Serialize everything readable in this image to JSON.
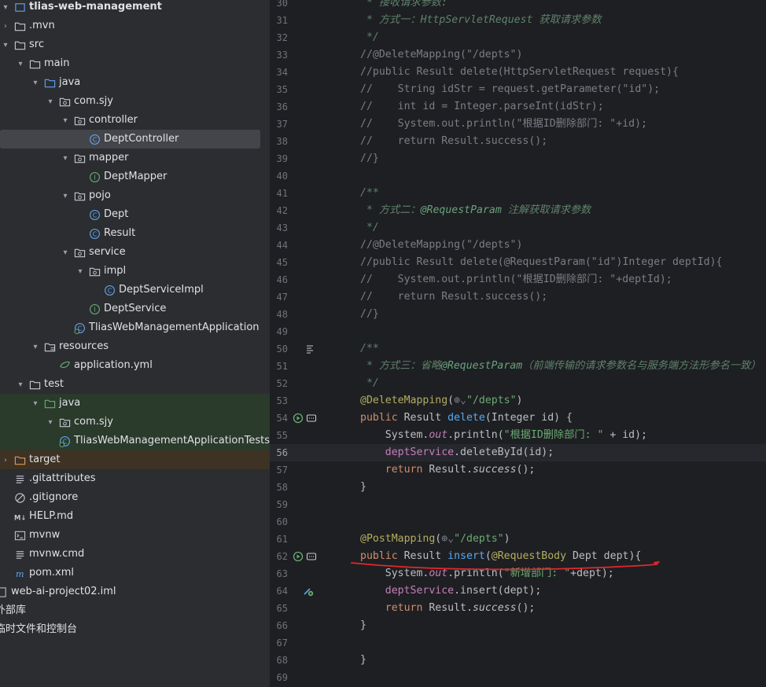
{
  "project_tree": {
    "items": [
      {
        "label": "tlias-web-management",
        "chevron": "▾",
        "icon": "module",
        "depth": 0,
        "bold": true
      },
      {
        "label": ".mvn",
        "chevron": "›",
        "icon": "folder",
        "depth": 0
      },
      {
        "label": "src",
        "chevron": "▾",
        "icon": "folder",
        "depth": 0
      },
      {
        "label": "main",
        "chevron": "▾",
        "icon": "folder",
        "depth": 1
      },
      {
        "label": "java",
        "chevron": "▾",
        "icon": "folder-blue",
        "depth": 2
      },
      {
        "label": "com.sjy",
        "chevron": "▾",
        "icon": "package",
        "depth": 3
      },
      {
        "label": "controller",
        "chevron": "▾",
        "icon": "package",
        "depth": 4
      },
      {
        "label": "DeptController",
        "chevron": "",
        "icon": "class",
        "depth": 5,
        "selected": true
      },
      {
        "label": "mapper",
        "chevron": "▾",
        "icon": "package",
        "depth": 4
      },
      {
        "label": "DeptMapper",
        "chevron": "",
        "icon": "interface",
        "depth": 5
      },
      {
        "label": "pojo",
        "chevron": "▾",
        "icon": "package",
        "depth": 4
      },
      {
        "label": "Dept",
        "chevron": "",
        "icon": "class",
        "depth": 5
      },
      {
        "label": "Result",
        "chevron": "",
        "icon": "class",
        "depth": 5
      },
      {
        "label": "service",
        "chevron": "▾",
        "icon": "package",
        "depth": 4
      },
      {
        "label": "impl",
        "chevron": "▾",
        "icon": "package",
        "depth": 5
      },
      {
        "label": "DeptServiceImpl",
        "chevron": "",
        "icon": "class",
        "depth": 6
      },
      {
        "label": "DeptService",
        "chevron": "",
        "icon": "interface",
        "depth": 5
      },
      {
        "label": "TliasWebManagementApplication",
        "chevron": "",
        "icon": "spring-class",
        "depth": 4
      },
      {
        "label": "resources",
        "chevron": "▾",
        "icon": "folder-res",
        "depth": 2
      },
      {
        "label": "application.yml",
        "chevron": "",
        "icon": "spring-yml",
        "depth": 3
      },
      {
        "label": "test",
        "chevron": "▾",
        "icon": "folder",
        "depth": 1
      },
      {
        "label": "java",
        "chevron": "▾",
        "icon": "folder-green",
        "depth": 2,
        "test": true
      },
      {
        "label": "com.sjy",
        "chevron": "▾",
        "icon": "package",
        "depth": 3,
        "test": true
      },
      {
        "label": "TliasWebManagementApplicationTests",
        "chevron": "",
        "icon": "spring-class",
        "depth": 4,
        "test": true
      },
      {
        "label": "target",
        "chevron": "›",
        "icon": "folder-orange",
        "depth": 0,
        "target": true
      },
      {
        "label": ".gitattributes",
        "chevron": "",
        "icon": "text-file",
        "depth": 0
      },
      {
        "label": ".gitignore",
        "chevron": "",
        "icon": "ignore-file",
        "depth": 0
      },
      {
        "label": "HELP.md",
        "chevron": "",
        "icon": "markdown-file",
        "depth": 0
      },
      {
        "label": "mvnw",
        "chevron": "",
        "icon": "terminal-file",
        "depth": 0
      },
      {
        "label": "mvnw.cmd",
        "chevron": "",
        "icon": "text-file",
        "depth": 0
      },
      {
        "label": "pom.xml",
        "chevron": "",
        "icon": "maven-file",
        "depth": 0
      },
      {
        "label": "web-ai-project02.iml",
        "chevron": "",
        "icon": "iml-file",
        "depth": -1
      },
      {
        "label": "外部库",
        "chevron": "",
        "icon": "none",
        "depth": -2
      },
      {
        "label": "临时文件和控制台",
        "chevron": "",
        "icon": "none",
        "depth": -2
      }
    ]
  },
  "editor": {
    "current_line": 56,
    "lines": [
      {
        "n": 30,
        "html": "<span class='doc'> * 接收请求参数:</span>"
      },
      {
        "n": 31,
        "html": "<span class='doc'> * 方式一：HttpServletRequest 获取请求参数</span>"
      },
      {
        "n": 32,
        "html": "<span class='doc'> */</span>"
      },
      {
        "n": 33,
        "html": "<span class='cm'>//@DeleteMapping(\"/depts\")</span>"
      },
      {
        "n": 34,
        "html": "<span class='cm'>//public Result delete(HttpServletRequest request){</span>"
      },
      {
        "n": 35,
        "html": "<span class='cm'>//    String idStr = request.getParameter(\"id\");</span>"
      },
      {
        "n": 36,
        "html": "<span class='cm'>//    int id = Integer.parseInt(idStr);</span>"
      },
      {
        "n": 37,
        "html": "<span class='cm'>//    System.out.println(\"根据ID删除部门: \"+id);</span>"
      },
      {
        "n": 38,
        "html": "<span class='cm'>//    return Result.success();</span>"
      },
      {
        "n": 39,
        "html": "<span class='cm'>//}</span>"
      },
      {
        "n": 40,
        "html": ""
      },
      {
        "n": 41,
        "html": "<span class='doc'>/**</span>"
      },
      {
        "n": 42,
        "html": "<span class='doc'> * 方式二：</span><span class='docb'>@RequestParam</span><span class='doc'> 注解获取请求参数</span>"
      },
      {
        "n": 43,
        "html": "<span class='doc'> */</span>"
      },
      {
        "n": 44,
        "html": "<span class='cm'>//@DeleteMapping(\"/depts\")</span>"
      },
      {
        "n": 45,
        "html": "<span class='cm'>//public Result delete(@RequestParam(\"id\")Integer deptId){</span>"
      },
      {
        "n": 46,
        "html": "<span class='cm'>//    System.out.println(\"根据ID删除部门: \"+deptId);</span>"
      },
      {
        "n": 47,
        "html": "<span class='cm'>//    return Result.success();</span>"
      },
      {
        "n": 48,
        "html": "<span class='cm'>//}</span>"
      },
      {
        "n": 49,
        "html": ""
      },
      {
        "n": 50,
        "html": "<span class='doc'>/**</span>"
      },
      {
        "n": 51,
        "html": "<span class='doc'> * 方式三：省略</span><span class='docb'>@RequestParam</span><span class='doc'>（前端传输的请求参数名与服务端方法形参名一致）</span>"
      },
      {
        "n": 52,
        "html": "<span class='doc'> */</span>"
      },
      {
        "n": 53,
        "html": "<span class='ann'>@DeleteMapping</span>(<span class='cm'>⊕⌄</span><span class='str'>\"/depts\"</span>)"
      },
      {
        "n": 54,
        "html": "<span class='kw'>public</span> Result <span class='fn'>delete</span>(Integer id) {"
      },
      {
        "n": 55,
        "html": "    System.<span class='fld it'>out</span>.println(<span class='str'>\"根据ID删除部门: \"</span> + id);"
      },
      {
        "n": 56,
        "html": "    <span class='fld'>deptService</span>.deleteById(id);"
      },
      {
        "n": 57,
        "html": "    <span class='kw'>return</span> Result.<span class='it'>success</span>();"
      },
      {
        "n": 58,
        "html": "}"
      },
      {
        "n": 59,
        "html": ""
      },
      {
        "n": 60,
        "html": ""
      },
      {
        "n": 61,
        "html": "<span class='ann'>@PostMapping</span>(<span class='cm'>⊕⌄</span><span class='str'>\"/depts\"</span>)"
      },
      {
        "n": 62,
        "html": "<span class='kw'>public</span> Result <span class='fn'>insert</span>(<span class='ann'>@RequestBody</span> Dept dept){"
      },
      {
        "n": 63,
        "html": "    System.<span class='fld it'>out</span>.println(<span class='str'>\"新增部门: \"</span>+dept);"
      },
      {
        "n": 64,
        "html": "    <span class='fld'>deptService</span>.insert(dept);"
      },
      {
        "n": 65,
        "html": "    <span class='kw'>return</span> Result.<span class='it'>success</span>();"
      },
      {
        "n": 66,
        "html": "}"
      },
      {
        "n": 67,
        "html": ""
      },
      {
        "n": 68,
        "html": "}"
      },
      {
        "n": 69,
        "html": ""
      }
    ]
  },
  "colors": {
    "accent_red_underline": "#e0282e",
    "selection_bg": "#43454a",
    "test_bg": "#2a3a2b"
  }
}
